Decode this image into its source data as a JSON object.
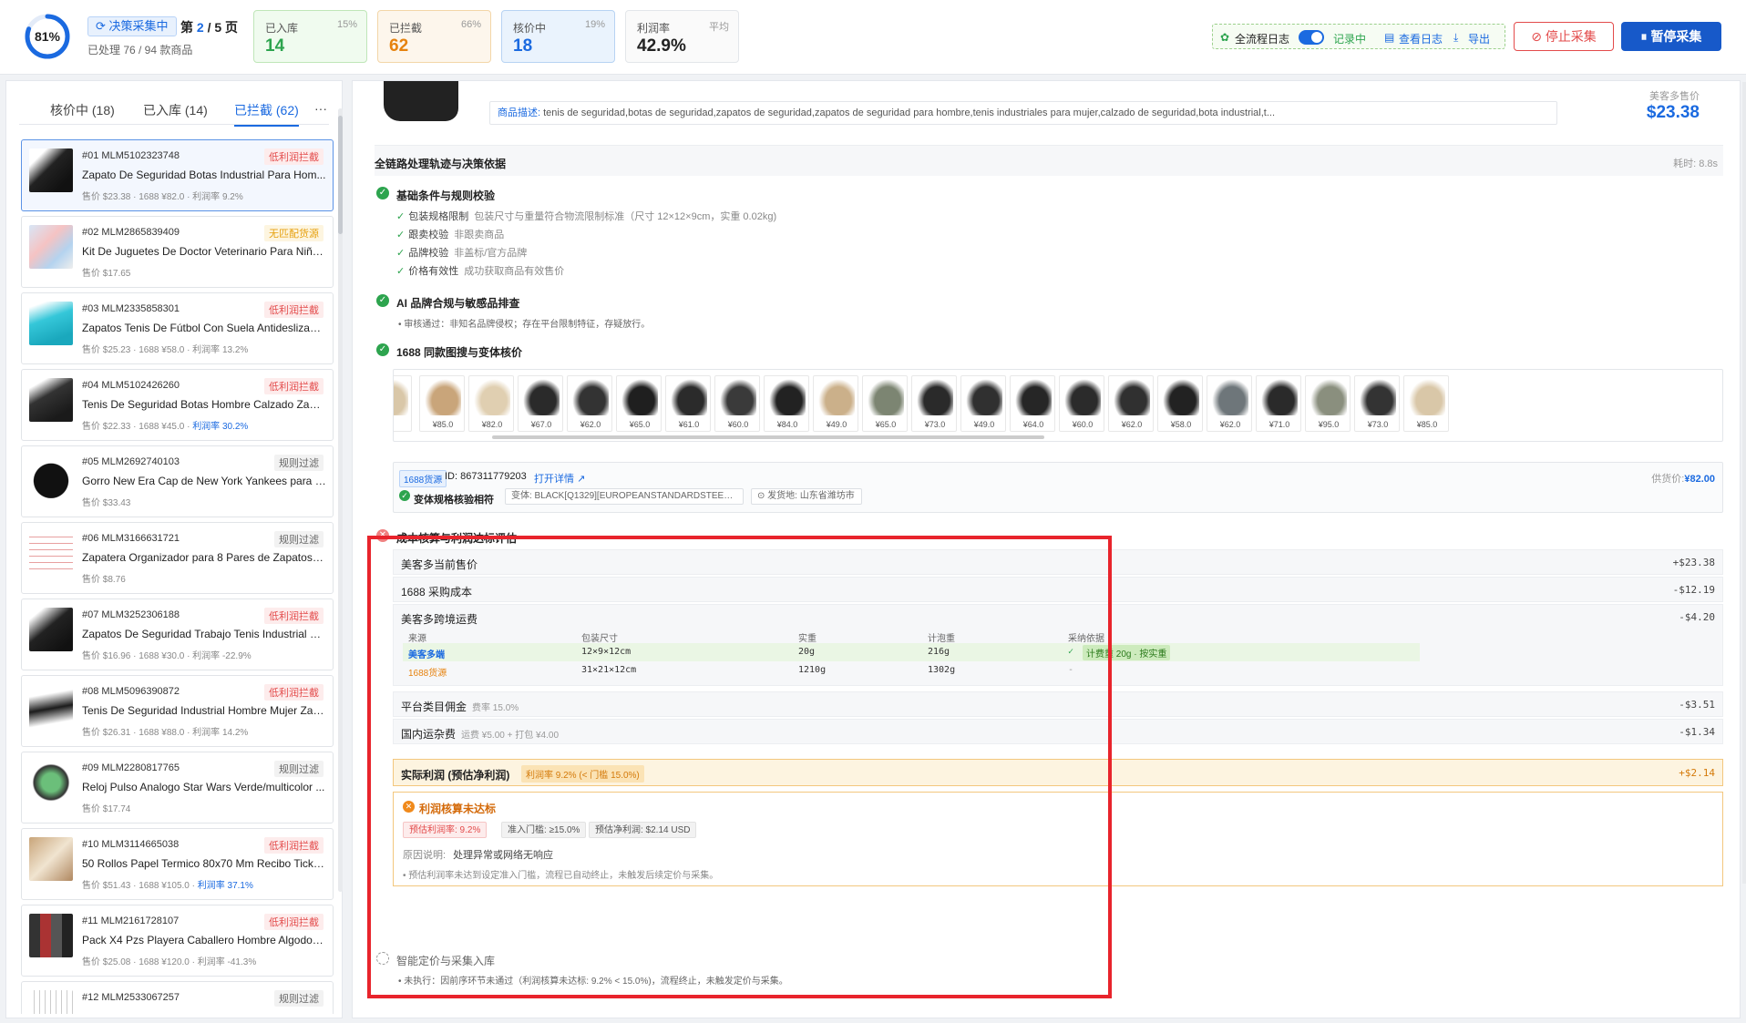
{
  "header": {
    "progress_text": "81%",
    "progress": 0.81,
    "collect_badge": "决策采集中",
    "page_prefix": "第",
    "page_current": "2",
    "page_rest": "/ 5 页",
    "processed": "已处理 76 / 94 款商品",
    "stats": [
      {
        "label": "已入库",
        "pct": "15%",
        "value": "14"
      },
      {
        "label": "已拦截",
        "pct": "66%",
        "value": "62"
      },
      {
        "label": "核价中",
        "pct": "19%",
        "value": "18"
      },
      {
        "label": "利润率",
        "pct": "平均",
        "value": "42.9%"
      }
    ],
    "log_label": "全流程日志",
    "log_status": "记录中",
    "log_view": "查看日志",
    "log_export": "导出",
    "stop_label": "停止采集",
    "pause_label": "暂停采集"
  },
  "left": {
    "tabs": [
      "核价中 (18)",
      "已入库 (14)",
      "已拦截 (62)"
    ],
    "more": "···",
    "items": [
      {
        "id": "#01 MLM5102323748",
        "tag": "低利润拦截",
        "title": "Zapato De Seguridad Botas Industrial Para Hom...",
        "meta": "售价 $23.38 · 1688 ¥82.0 · 利润率 9.2%",
        "pos": ""
      },
      {
        "id": "#02 MLM2865839409",
        "tag": "无匹配货源",
        "title": "Kit De Juguetes De Doctor Veterinario Para Niño...",
        "meta": "售价 $17.65",
        "pos": ""
      },
      {
        "id": "#03 MLM2335858301",
        "tag": "低利润拦截",
        "title": "Zapatos Tenis De Fútbol Con Suela Antideslizant...",
        "meta": "售价 $25.23 · 1688 ¥58.0 · 利润率 13.2%",
        "pos": ""
      },
      {
        "id": "#04 MLM5102426260",
        "tag": "低利润拦截",
        "title": "Tenis De Seguridad Botas Hombre Calzado Zapa...",
        "meta": "售价 $22.33 · 1688 ¥45.0 · ",
        "pos": "利润率 30.2%"
      },
      {
        "id": "#05 MLM2692740103",
        "tag": "规则过滤",
        "title": "Gorro New Era Cap de New York Yankees para H...",
        "meta": "售价 $33.43",
        "pos": ""
      },
      {
        "id": "#06 MLM3166631721",
        "tag": "规则过滤",
        "title": "Zapatera Organizador para 8 Pares de Zapatos, ...",
        "meta": "售价 $8.76",
        "pos": ""
      },
      {
        "id": "#07 MLM3252306188",
        "tag": "低利润拦截",
        "title": "Zapatos De Seguridad Trabajo Tenis Industrial H...",
        "meta": "售价 $16.96 · 1688 ¥30.0 · 利润率 -22.9%",
        "pos": ""
      },
      {
        "id": "#08 MLM5096390872",
        "tag": "低利润拦截",
        "title": "Tenis De Seguridad Industrial Hombre Mujer Zap...",
        "meta": "售价 $26.31 · 1688 ¥88.0 · 利润率 14.2%",
        "pos": ""
      },
      {
        "id": "#09 MLM2280817765",
        "tag": "规则过滤",
        "title": "Reloj Pulso Analogo Star Wars Verde/multicolor ...",
        "meta": "售价 $17.74",
        "pos": ""
      },
      {
        "id": "#10 MLM3114665038",
        "tag": "低利润拦截",
        "title": "50 Rollos Papel Termico 80x70 Mm Recibo Ticket...",
        "meta": "售价 $51.43 · 1688 ¥105.0 · ",
        "pos": "利润率 37.1%"
      },
      {
        "id": "#11 MLM2161728107",
        "tag": "低利润拦截",
        "title": "Pack X4 Pzs Playera Caballero Hombre Algodon ...",
        "meta": "售价 $25.08 · 1688 ¥120.0 · 利润率 -41.3%",
        "pos": ""
      },
      {
        "id": "#12 MLM2533067257",
        "tag": "规则过滤",
        "title": "",
        "meta": "",
        "pos": ""
      }
    ]
  },
  "detail": {
    "desc_label": "商品描述:",
    "desc_text": "tenis de seguridad,botas de seguridad,zapatos de seguridad,zapatos de seguridad para hombre,tenis industriales para mujer,calzado de seguridad,bota industrial,t...",
    "price_label": "美客多售价",
    "price_value": "$23.38",
    "trail_title": "全链路处理轨迹与决策依据",
    "trail_elapsed": "耗时: 8.8s",
    "sec1_title": "基础条件与规则校验",
    "sec1_checks": [
      {
        "k": "包装规格限制",
        "v": "包装尺寸与重量符合物流限制标准（尺寸 12×12×9cm，实重 0.02kg)"
      },
      {
        "k": "跟卖校验",
        "v": "非跟卖商品"
      },
      {
        "k": "品牌校验",
        "v": "非盖标/官方品牌"
      },
      {
        "k": "价格有效性",
        "v": "成功获取商品有效售价"
      }
    ],
    "sec2_title": "AI 品牌合规与敏感品排查",
    "sec2_note": "• 审核通过：非知名品牌侵权；存在平台限制特征，存疑放行。",
    "sec3_title": "1688 同款图搜与变体核价",
    "pics": [
      "0",
      "¥85.0",
      "¥82.0",
      "¥67.0",
      "¥62.0",
      "¥65.0",
      "¥61.0",
      "¥60.0",
      "¥84.0",
      "¥49.0",
      "¥65.0",
      "¥73.0",
      "¥49.0",
      "¥64.0",
      "¥60.0",
      "¥62.0",
      "¥58.0",
      "¥62.0",
      "¥71.0",
      "¥95.0",
      "¥73.0",
      "¥85.0"
    ],
    "src_tag": "1688货源",
    "src_id": "ID: 867311779203",
    "src_link": "打开详情",
    "supply_label": "供货价:",
    "supply_value": "¥82.00",
    "var_ok": "变体规格核验相符",
    "var_chip": "变体: BLACK[Q1329][EUROPEANSTANDARDSTEELHEADEURO...",
    "ship_from": "发货地: 山东省潍坊市",
    "sec4_title": "成本核算与利润达标评估",
    "cost_rows": [
      {
        "label": "美客多当前售价",
        "sub": "",
        "value": "+$23.38"
      },
      {
        "label": "1688 采购成本",
        "sub": "",
        "value": "-$12.19"
      }
    ],
    "ship_label": "美客多跨境运费",
    "ship_value": "-$4.20",
    "ship_headers": [
      "来源",
      "包装尺寸",
      "实重",
      "计泡重",
      "采纳依据"
    ],
    "ship_rows": [
      {
        "src": "美客多端",
        "size": "12×9×12cm",
        "w": "20g",
        "vw": "216g",
        "basis": "计费重 20g · 按实重"
      },
      {
        "src": "1688货源",
        "size": "31×21×12cm",
        "w": "1210g",
        "vw": "1302g",
        "basis": "-"
      }
    ],
    "cost_rows2": [
      {
        "label": "平台类目佣金",
        "sub": "费率 15.0%",
        "value": "-$3.51"
      },
      {
        "label": "国内运杂费",
        "sub": "运费 ¥5.00 + 打包 ¥4.00",
        "value": "-$1.34"
      }
    ],
    "profit_label": "实际利润 (预估净利润)",
    "profit_chip": "利润率 9.2% (< 门槛 15.0%)",
    "profit_value": "+$2.14",
    "warn_title": "利润核算未达标",
    "warn_chips": [
      "预估利润率: 9.2%",
      "准入门槛: ≥15.0%",
      "预估净利润: $2.14 USD"
    ],
    "reason_label": "原因说明:",
    "reason_text": "处理异常或网络无响应",
    "warn_note": "• 预估利润率未达到设定准入门槛，流程已自动终止，未触发后续定价与采集。",
    "sec5_title": "智能定价与采集入库",
    "sec5_note": "• 未执行：因前序环节未通过（利润核算未达标: 9.2% < 15.0%)，流程终止，未触发定价与采集。"
  },
  "colors": {
    "accent": "#1b6ae0",
    "success": "#2da44e",
    "warning": "#e6820e",
    "danger": "#e34b4b"
  }
}
